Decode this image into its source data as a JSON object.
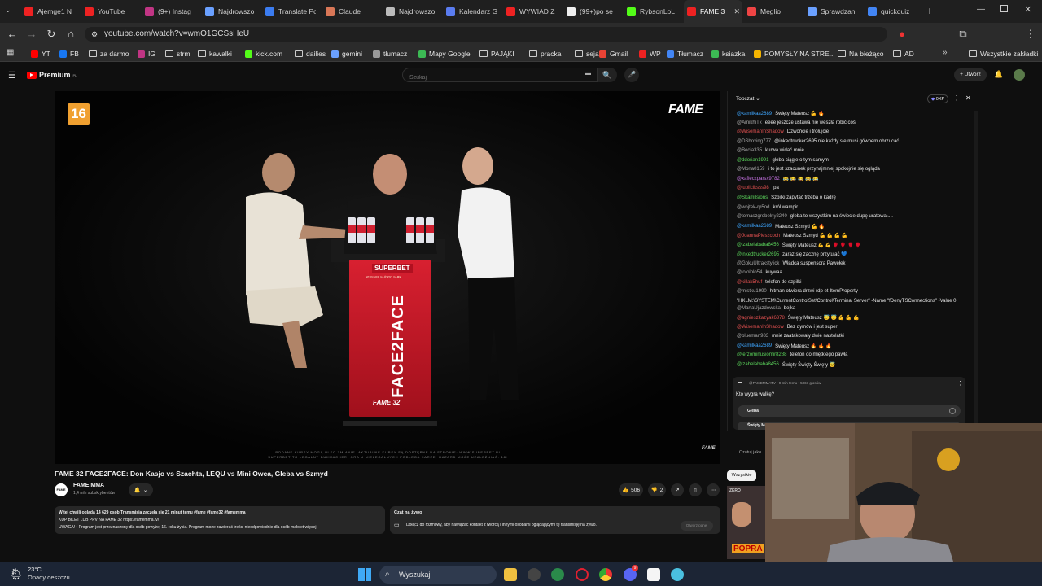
{
  "browser": {
    "tabs": [
      {
        "title": "Ajemge1 N",
        "color": "#e22"
      },
      {
        "title": "YouTube",
        "color": "#e22"
      },
      {
        "title": "(9+) Instag",
        "color": "#c13584"
      },
      {
        "title": "Najdrowszo",
        "color": "#6aa0ff"
      },
      {
        "title": "Translate Po",
        "color": "#3b7cf0"
      },
      {
        "title": "Claude",
        "color": "#d97757"
      },
      {
        "title": "Najdrowszo",
        "color": "#bbb"
      },
      {
        "title": "Kalendarz G",
        "color": "#5a7cf0"
      },
      {
        "title": "WYWIAD Z",
        "color": "#e22"
      },
      {
        "title": "(99+)po se",
        "color": "#eee"
      },
      {
        "title": "RybsonLoL",
        "color": "#53fc18"
      },
      {
        "title": "FAME 3",
        "color": "#e22"
      },
      {
        "title": "Meglio",
        "color": "#e44"
      },
      {
        "title": "Sprawdzan",
        "color": "#6aa0ff"
      },
      {
        "title": "quickquiz",
        "color": "#4285f4"
      }
    ],
    "new_tab": "+",
    "url": "youtube.com/watch?v=wmQ1GCSsHeU",
    "bookmarks": [
      "YT",
      "FB",
      "za darmo",
      "IG",
      "strm",
      "kawalki",
      "kick.com",
      "dailies",
      "gemini",
      "tłumacz",
      "Mapy Google",
      "PAJĄKI",
      "pracka",
      "sejak",
      "Gmail",
      "WP",
      "Tłumacz",
      "ksiazka",
      "POMYSŁY NA STRE...",
      "Na bieżąco",
      "AD"
    ],
    "bookmarks_more": "»",
    "all_bookmarks": "Wszystkie zakładki"
  },
  "yt": {
    "logo": "Premium",
    "logo_sup": "PL",
    "search_placeholder": "Szukaj",
    "create": "Utwórz"
  },
  "video": {
    "age_badge": "16",
    "brand": "FAME",
    "sponsor": "SUPERBET",
    "sponsor_sub": "SPONSOR GŁÓWNY FAME",
    "stand_text": "FACE2FACE",
    "stand_brand": "FAME 32",
    "disclaimer1": "PODANE KURSY MOGĄ ULEC ZMIANIE. AKTUALNE KURSY SĄ DOSTĘPNE NA STRONIE: WWW.SUPERBET.PL",
    "disclaimer2": "SUPERBET TO LEGALNY BUKMACHER. GRA U NIELEGALNYCH PODLEGA KARZE. HAZARD MOŻE UZALEŻNIAĆ. 18+",
    "corner": "FAME",
    "title": "FAME 32 FACE2FACE: Don Kasjo vs Szachta, LEQU vs Mini Owca, Gleba vs Szmyd",
    "channel": "FAME MMA",
    "subs": "1,4 mln subskrybentów",
    "likes": "506",
    "dislikes": "2",
    "desc1": "W tej chwili ogląda 14 629 osób  Transmisja zaczęła się 21 minut temu  #fame #fame32 #famemma",
    "desc2": "KUP BILET LUB PPV NA FAME 32  https://famemma.tv/",
    "desc3": "UWAGA! • Program jest przeznaczony dla osób powyżej 16. roku życia. Program może zawierać treści nieodpowiednie dla osób małolet  więcej",
    "live_chat_title": "Czat na żywo",
    "live_chat_text": "Dołącz do rozmowy, aby nawiązać kontakt z twórcą i innymi osobami oglądającymi tę transmisję na żywo.",
    "open_panel": "Otwórz panel"
  },
  "chat": {
    "header": "Topczat",
    "xp": "0XP",
    "messages": [
      {
        "author": "@kamilkaa2689",
        "color": "#3ea6ff",
        "text": "Święty Mateusz 💪 🔥"
      },
      {
        "author": "@AmikhiTx",
        "color": "#aaa",
        "text": "eeee jeszcze ustawa nie weszła robić coś"
      },
      {
        "author": "@WisemanInShadow",
        "color": "#e05050",
        "text": "Dzwońcie i trołujcie"
      },
      {
        "author": "@DSboxing777",
        "color": "#aaa",
        "text": "@inkedtrucker2695 nie każdy sie musi gównem obrzucać"
      },
      {
        "author": "@Becia335",
        "color": "#aaa",
        "text": "kurwa widać mnie"
      },
      {
        "author": "@ddorian1991",
        "color": "#5cd65c",
        "text": "gleba ciągle o tym samym"
      },
      {
        "author": "@Mona0159",
        "color": "#aaa",
        "text": "i to jest szacunek przynajmniej spokojnie się ogląda"
      },
      {
        "author": "@xafleczparsx9782",
        "color": "#c873e6",
        "text": "😂 😂 😂 😂 😂"
      },
      {
        "author": "@lubiiciksss98",
        "color": "#e05050",
        "text": "ipa"
      },
      {
        "author": "@Skamilsions",
        "color": "#5cd65c",
        "text": "Szpilki zapytać trzeba o kadrę"
      },
      {
        "author": "@wojtek-rp5od",
        "color": "#aaa",
        "text": "król wampir"
      },
      {
        "author": "@tomaszgrobelny2240",
        "color": "#aaa",
        "text": "gleba to wszystkim na świecie dupę uratował...."
      },
      {
        "author": "@kamilkaa2689",
        "color": "#3ea6ff",
        "text": "Mateusz Szmyd 💪 🔥"
      },
      {
        "author": "@JoannaPleszcoch",
        "color": "#e05050",
        "text": "Mateusz Szmyd 💪 💪 💪 💪"
      },
      {
        "author": "@izabelababa8456",
        "color": "#5cd65c",
        "text": "Święty Mateusz 💪 💪 🥊 🥊 🥊 🥊"
      },
      {
        "author": "@inkedtrucker2695",
        "color": "#5cd65c",
        "text": "zaraz się zacznę przytulać 💙"
      },
      {
        "author": "@GokuUltrakstylick",
        "color": "#aaa",
        "text": "Władca suspensora Pawełek"
      },
      {
        "author": "@lolololo54",
        "color": "#aaa",
        "text": "kuywaa"
      },
      {
        "author": "@killak5huf",
        "color": "#e05050",
        "text": "telefon do szpilki"
      },
      {
        "author": "@mistku1990",
        "color": "#aaa",
        "text": "hitman otwiera drzwi rdp et-ItemProperty"
      },
      {
        "author": "",
        "color": "#aaa",
        "text": "\"HKLM:\\SYSTEM\\CurrentControlSet\\Control\\Terminal Server\" -Name \"fDenyTSConnections\" -Value 0"
      },
      {
        "author": "@MartaUjazdowska",
        "color": "#aaa",
        "text": "bejka"
      },
      {
        "author": "@agnieszkazyak6378",
        "color": "#e05050",
        "text": "Święty Mateusz 😇 😇 💪 💪 💪"
      },
      {
        "author": "@WisemanInShadow",
        "color": "#e05050",
        "text": "Bez dymów i jest super"
      },
      {
        "author": "@blueman983",
        "color": "#aaa",
        "text": "mnie zaatakowały dwie nastolatki"
      },
      {
        "author": "@kamilkaa2689",
        "color": "#3ea6ff",
        "text": "Święty Mateusz 🔥 🔥 🔥"
      },
      {
        "author": "@jerzominusiomir8288",
        "color": "#5cd65c",
        "text": "telefon do miętkiego pawła"
      },
      {
        "author": "@izabelababa8456",
        "color": "#5cd65c",
        "text": "Święty Święty Święty 😇"
      }
    ],
    "poll_author": "@FAMEMMATV • 9 min temu • 5067 głosów",
    "poll_question": "Kto wygra walkę?",
    "poll_option1": "Gleba",
    "poll_option2": "Święty Mate",
    "chat_as": "Czatuj jako",
    "filter_all": "Wszystkie",
    "thumb_text": "POPRA",
    "thumb_brand": "ZERO"
  },
  "taskbar": {
    "temp": "23°C",
    "weather": "Opady deszczu",
    "search": "Wyszukaj",
    "badge": "9"
  }
}
